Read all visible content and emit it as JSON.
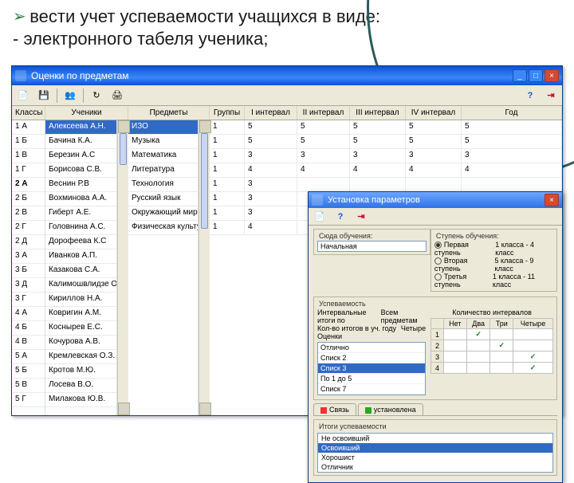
{
  "slide": {
    "title": "вести учет успеваемости учащихся в виде:",
    "sub": "- электронного табеля ученика;"
  },
  "main_window": {
    "title": "Оценки по предметам",
    "toolbar_icons": [
      "doc",
      "save",
      "sep",
      "people",
      "sep",
      "refresh",
      "print",
      "sep",
      "gap",
      "help",
      "exit"
    ],
    "headers": {
      "klassy": "Классы",
      "ucheniki": "Ученики",
      "predmety": "Предметы",
      "gruppy": "Группы",
      "int1": "I интервал",
      "int2": "II интервал",
      "int3": "III интервал",
      "int4": "IV интервал",
      "god": "Год"
    },
    "classes": [
      "1 А",
      "1 Б",
      "1 В",
      "1 Г",
      "2 А",
      "2 Б",
      "2 В",
      "2 Г",
      "2 Д",
      "3 А",
      "3 Б",
      "3 Д",
      "3 Г",
      "4 А",
      "4 Б",
      "4 В",
      "5 А",
      "5 Б",
      "5 В",
      "5 Г"
    ],
    "class_selected_index": 4,
    "students": [
      "Алексеева А.Н.",
      "Бачина К.А.",
      "Березин А.С",
      "Борисова С.В.",
      "Веснин Р.В",
      "Вохминова А.А.",
      "Гиберт А.Е.",
      "Головнина А.С.",
      "Дорофеева К.С",
      "Иванков А.П.",
      "Казакова С.А.",
      "Калимошвлидзе О.К.",
      "Кириллов Н.А.",
      "Ковригин А.М.",
      "Коснырев Е.С.",
      "Кочурова А.В.",
      "Кремлевская О.З.",
      "Кротов М.Ю.",
      "Лосева В.О.",
      "Милакова Ю.В."
    ],
    "student_selected_index": 0,
    "subjects": [
      "ИЗО",
      "Музыка",
      "Математика",
      "Литература",
      "Технология",
      "Русский язык",
      "Окружающий мир",
      "Физическая культура"
    ],
    "subject_selected_index": 0,
    "grades": [
      {
        "g": "1",
        "i1": "5",
        "i2": "5",
        "i3": "5",
        "i4": "5",
        "y": "5"
      },
      {
        "g": "1",
        "i1": "5",
        "i2": "5",
        "i3": "5",
        "i4": "5",
        "y": "5"
      },
      {
        "g": "1",
        "i1": "3",
        "i2": "3",
        "i3": "3",
        "i4": "3",
        "y": "3"
      },
      {
        "g": "1",
        "i1": "4",
        "i2": "4",
        "i3": "4",
        "i4": "4",
        "y": "4"
      },
      {
        "g": "1",
        "i1": "3",
        "i2": "",
        "i3": "",
        "i4": "",
        "y": ""
      },
      {
        "g": "1",
        "i1": "3",
        "i2": "",
        "i3": "",
        "i4": "",
        "y": ""
      },
      {
        "g": "1",
        "i1": "3",
        "i2": "",
        "i3": "",
        "i4": "",
        "y": ""
      },
      {
        "g": "1",
        "i1": "4",
        "i2": "",
        "i3": "",
        "i4": "",
        "y": ""
      }
    ]
  },
  "dialog": {
    "title": "Установка параметров",
    "section_school": "Сюда обучения:",
    "school_value": "Начальная",
    "section_step": "Ступень обучения:",
    "step_options": [
      {
        "label": "Первая ступень",
        "range": "1 класса - 4 класс",
        "on": true
      },
      {
        "label": "Вторая ступень",
        "range": "5 класса - 9 класс",
        "on": false
      },
      {
        "label": "Третья ступень",
        "range": "1 класса - 11 класс",
        "on": false
      }
    ],
    "section_usp": "Успеваемость",
    "usp_left_label1": "Интервальные итоги по",
    "usp_left_value1": "Всем предметам",
    "usp_left_label2": "Кол-во итогов в уч. году",
    "usp_left_value2": "Четыре",
    "usp_left_label3": "Оценки",
    "usp_left_value3": "",
    "grade_systems": [
      "Отлично",
      "Списк 2",
      "Списк 3",
      "По 1 до 5",
      "Списк 7"
    ],
    "grade_system_selected": 2,
    "section_kol": "Количество интервалов",
    "kol_headers": [
      "",
      "Нет",
      "Два",
      "Три",
      "Четыре"
    ],
    "kol_rows": [
      {
        "label": "1",
        "cells": [
          "",
          "✓",
          "",
          ""
        ]
      },
      {
        "label": "2",
        "cells": [
          "",
          "",
          "✓",
          ""
        ]
      },
      {
        "label": "3",
        "cells": [
          "",
          "",
          "",
          "✓"
        ]
      },
      {
        "label": "4",
        "cells": [
          "",
          "",
          "",
          "✓"
        ]
      }
    ],
    "tab_link": "Связь",
    "tab_set": "установлена",
    "section_itogi": "Итоги успеваемости",
    "status_list": [
      "Не освоивший",
      "Освоивший",
      "Хорошист",
      "Отличник"
    ],
    "status_selected": 1
  }
}
